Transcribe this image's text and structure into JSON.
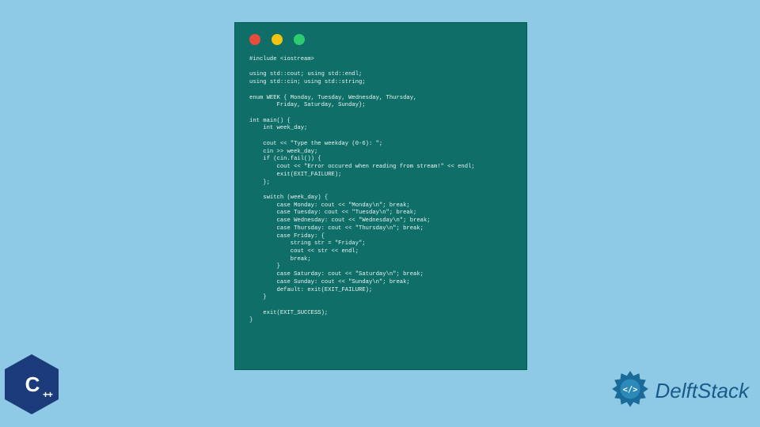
{
  "code_window": {
    "content": "#include <iostream>\n\nusing std::cout; using std::endl;\nusing std::cin; using std::string;\n\nenum WEEK { Monday, Tuesday, Wednesday, Thursday,\n        Friday, Saturday, Sunday};\n\nint main() {\n    int week_day;\n\n    cout << \"Type the weekday (0-6): \";\n    cin >> week_day;\n    if (cin.fail()) {\n        cout << \"Error occured when reading from stream!\" << endl;\n        exit(EXIT_FAILURE);\n    };\n\n    switch (week_day) {\n        case Monday: cout << \"Monday\\n\"; break;\n        case Tuesday: cout << \"Tuesday\\n\"; break;\n        case Wednesday: cout << \"Wednesday\\n\"; break;\n        case Thursday: cout << \"Thursday\\n\"; break;\n        case Friday: {\n            string str = \"Friday\";\n            cout << str << endl;\n            break;\n        }\n        case Saturday: cout << \"Saturday\\n\"; break;\n        case Sunday: cout << \"Sunday\\n\"; break;\n        default: exit(EXIT_FAILURE);\n    }\n\n    exit(EXIT_SUCCESS);\n}"
  },
  "cpp_logo": {
    "main": "C",
    "suffix": "++"
  },
  "brand": {
    "name": "DelftStack"
  },
  "colors": {
    "background": "#8ecae6",
    "code_bg": "#0f6e68",
    "code_text": "#e8f5f3",
    "cpp_hex": "#1b3b7a",
    "brand_text": "#1a5a8a"
  }
}
